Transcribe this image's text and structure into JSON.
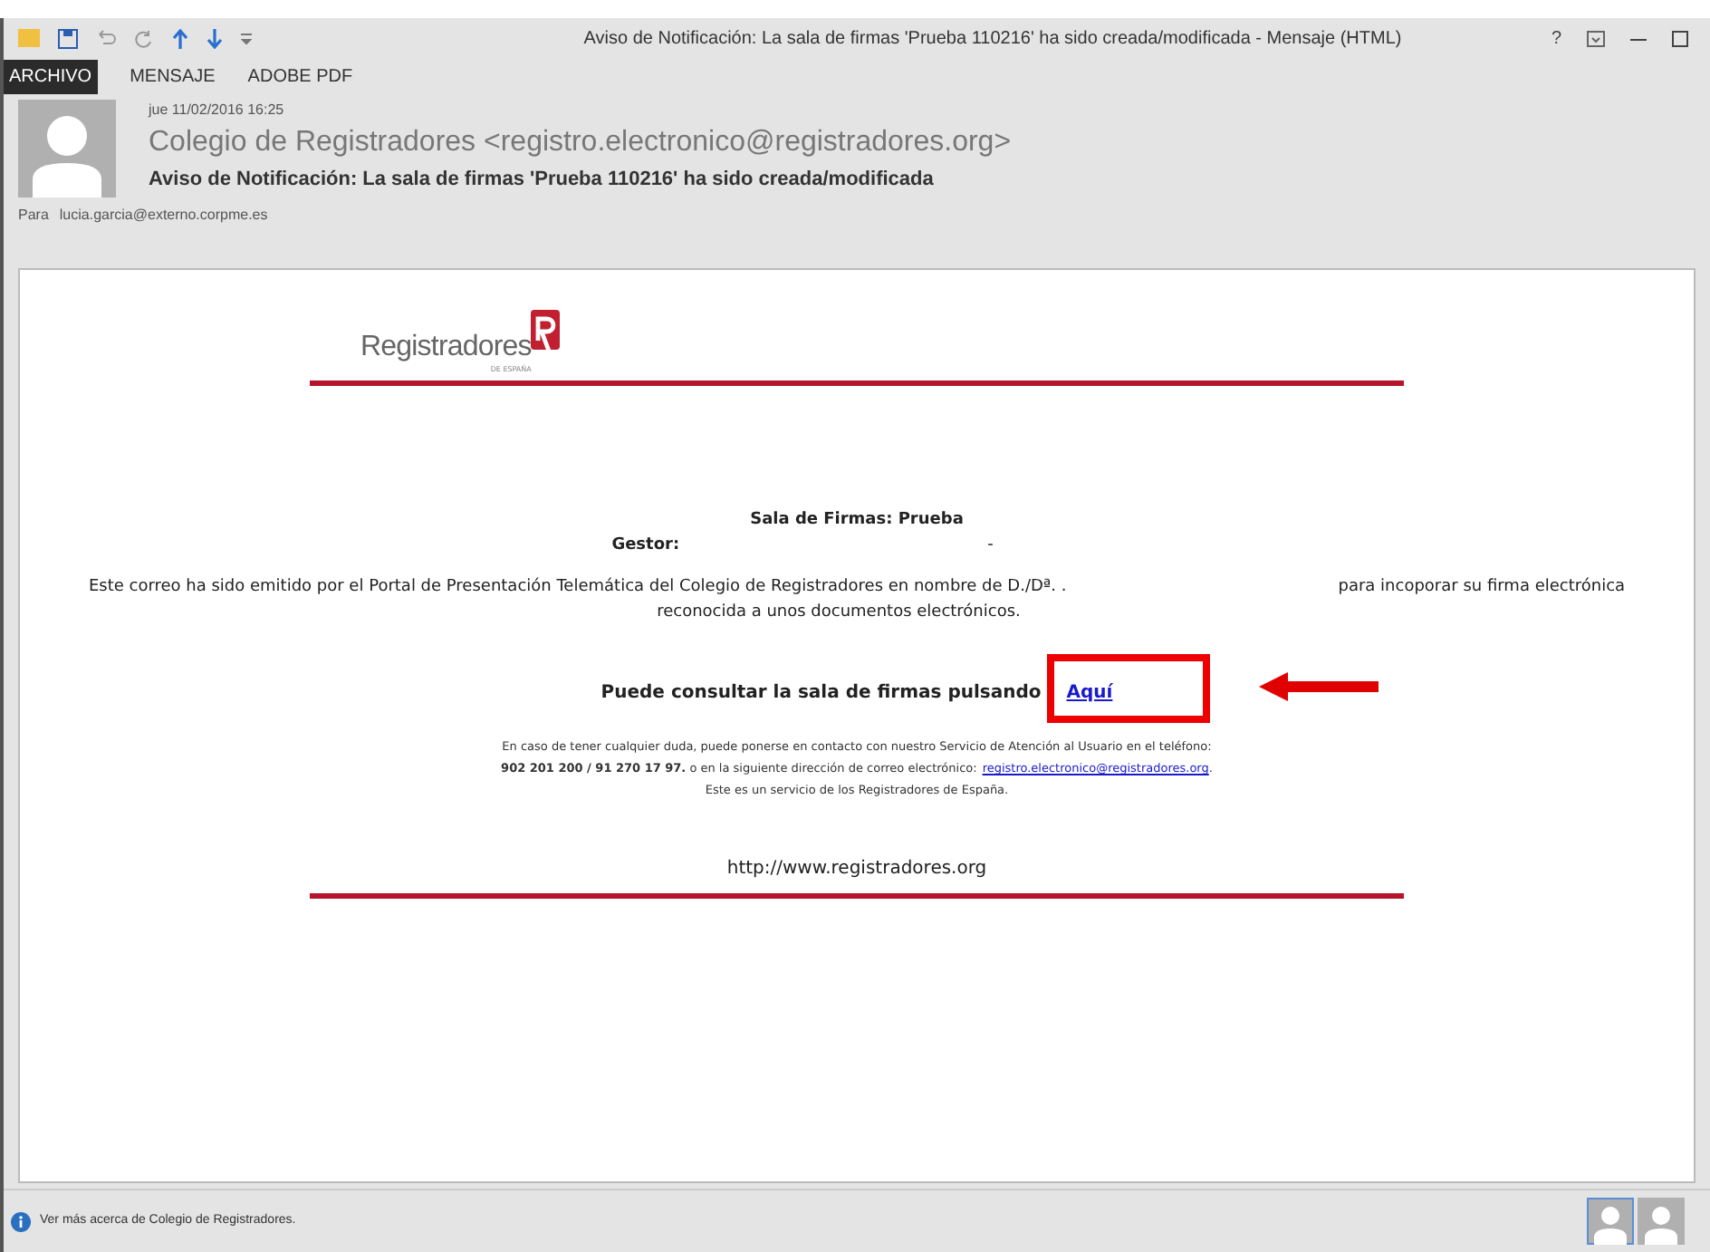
{
  "window": {
    "title": "Aviso de Notificación: La sala de firmas 'Prueba 110216' ha sido creada/modificada - Mensaje (HTML)",
    "controls": [
      "?"
    ]
  },
  "ribbon_tabs": [
    {
      "label": "ARCHIVO",
      "kind": "file"
    },
    {
      "label": "MENSAJE",
      "kind": "tab"
    },
    {
      "label": "ADOBE PDF",
      "kind": "tab"
    }
  ],
  "header": {
    "date": "jue 11/02/2016 16:25",
    "sender": "Colegio de Registradores <registro.electronico@registradores.org>",
    "subject": "Aviso de Notificación: La sala de firmas 'Prueba 110216' ha sido creada/modificada",
    "to_label": "Para",
    "to": "lucia.garcia@externo.corpme.es"
  },
  "body": {
    "logo_name": "Registradores",
    "logo_sub": "DE ESPAÑA",
    "room": "Sala de Firmas: Prueba",
    "manager_label": "Gestor:",
    "manager_value": "-",
    "intro_start": "Este correo ha sido emitido por el Portal de Presentación Telemática del Colegio de Registradores en nombre de D./Dª. .",
    "intro_end": "para incoporar su firma electrónica",
    "intro_cont": "reconocida a unos documentos electrónicos.",
    "consult": "Puede consultar la sala de firmas pulsando",
    "consult_link": "Aquí",
    "contact_1": "En caso de tener cualquier duda, puede ponerse en contacto con nuestro Servicio de Atención al Usuario en el teléfono:",
    "contact_2": "**902 201 200 / 91 270 17 97.** o en la siguiente dirección de correo electrónico:",
    "contact_email": "registro.electronico@registradores.org",
    "contact_2_end": ".",
    "contact_3": "Este es un servicio de los Registradores de España.",
    "url": "http://www.registradores.org"
  },
  "status_bar": {
    "text": "Ver más acerca de Colegio de Registradores."
  }
}
